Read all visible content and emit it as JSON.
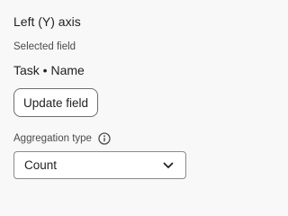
{
  "panel": {
    "section_title": "Left (Y) axis",
    "selected_field_label": "Selected field",
    "selected_field_value": "Task • Name",
    "update_button_label": "Update field",
    "aggregation_label": "Aggregation type",
    "aggregation_value": "Count"
  },
  "icons": {
    "info": "info-icon",
    "dropdown": "chevron-down-icon"
  },
  "colors": {
    "background": "#f8f8f8",
    "text": "#222222",
    "muted_text": "#4b4b4b",
    "border": "#8a8a8a"
  }
}
